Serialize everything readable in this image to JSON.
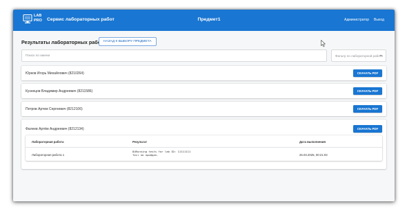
{
  "app": {
    "logo_line1": "LAB",
    "logo_line2": "PRO",
    "title": "Сервис лабораторных работ",
    "subject": "Предмет1",
    "admin_link": "Администратор",
    "logout_link": "Выход",
    "brand_color": "#1976d2"
  },
  "page": {
    "title": "Результаты лабораторных работ",
    "back_button": "НАЗАД К ВЫБОРУ ПРЕДМЕТА"
  },
  "search": {
    "placeholder": "Поиск по имени"
  },
  "filter": {
    "placeholder": "Фильтр по лабораторной работе"
  },
  "students": [
    {
      "name": "Юрков Игорь Михайлович (8210264)",
      "button": "СКАЧАТЬ PDF"
    },
    {
      "name": "Кузнецов Владимир Андреевич (8211586)",
      "button": "СКАЧАТЬ PDF"
    },
    {
      "name": "Петров Артем Сергеевич (8212106)",
      "button": "СКАЧАТЬ PDF"
    },
    {
      "name": "Фалеев Артём Андреевич (8212134)",
      "button": "СКАЧАТЬ PDF"
    }
  ],
  "results_table": {
    "headers": [
      "Лабораторная работа",
      "Результат",
      "Дата выполнения"
    ],
    "rows": [
      {
        "lab": "Лабораторная работа 1",
        "result_line1": "DURunning tests for lab ID: 11111111",
        "result_line2": "Тест не пройден.",
        "date": "26.03.2025, 00:21:03"
      }
    ]
  }
}
